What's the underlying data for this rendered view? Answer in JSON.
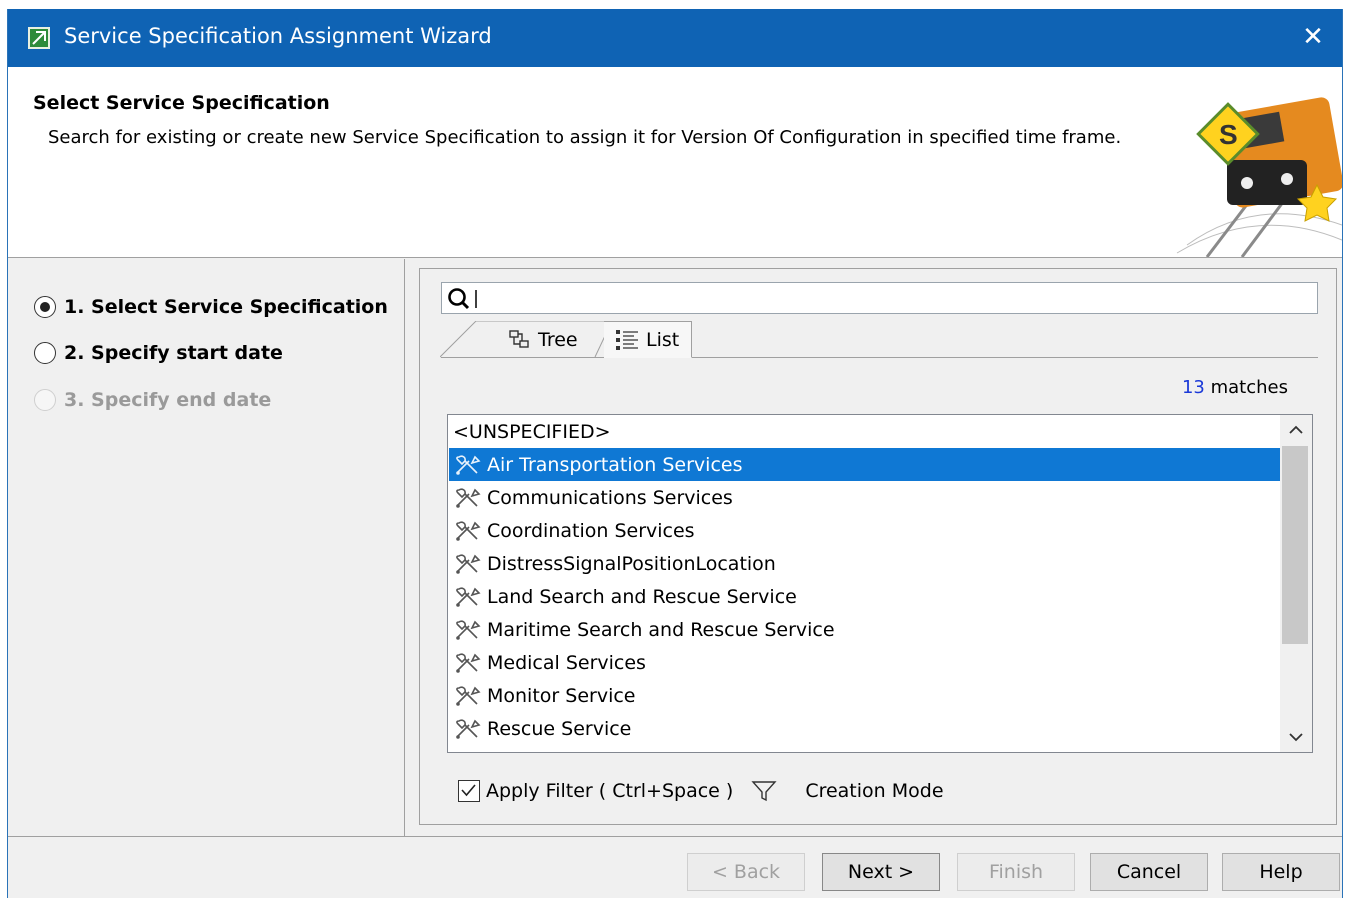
{
  "window": {
    "title": "Service Specification Assignment Wizard",
    "close_label": "✕"
  },
  "banner": {
    "title": "Select Service Specification",
    "description": "Search for existing or create new Service Specification to assign it for Version Of Configuration in specified time frame."
  },
  "steps": [
    {
      "label": "1. Select Service Specification",
      "state": "selected"
    },
    {
      "label": "2. Specify start date",
      "state": "enabled"
    },
    {
      "label": "3. Specify end date",
      "state": "disabled"
    }
  ],
  "search": {
    "value": "",
    "placeholder": ""
  },
  "tabs": {
    "tree_label": "Tree",
    "list_label": "List",
    "active": "List"
  },
  "matches": {
    "count": "13",
    "label": "matches"
  },
  "list": {
    "items": [
      {
        "label": "<UNSPECIFIED>",
        "icon": "none",
        "selected": false
      },
      {
        "label": "Air Transportation Services",
        "icon": "service-specification-icon",
        "selected": true
      },
      {
        "label": "Communications Services",
        "icon": "service-specification-icon",
        "selected": false
      },
      {
        "label": "Coordination Services",
        "icon": "service-specification-icon",
        "selected": false
      },
      {
        "label": "DistressSignalPositionLocation",
        "icon": "service-specification-icon",
        "selected": false
      },
      {
        "label": "Land Search and Rescue Service",
        "icon": "service-specification-icon",
        "selected": false
      },
      {
        "label": "Maritime Search and Rescue Service",
        "icon": "service-specification-icon",
        "selected": false
      },
      {
        "label": "Medical Services",
        "icon": "service-specification-icon",
        "selected": false
      },
      {
        "label": "Monitor Service",
        "icon": "service-specification-icon",
        "selected": false
      },
      {
        "label": "Rescue Service",
        "icon": "service-specification-icon",
        "selected": false
      }
    ]
  },
  "filter": {
    "apply_label": "Apply Filter ( Ctrl+Space )",
    "apply_checked": true,
    "creation_mode_label": "Creation Mode"
  },
  "buttons": {
    "back": "< Back",
    "next": "Next >",
    "finish": "Finish",
    "cancel": "Cancel",
    "help": "Help"
  },
  "colors": {
    "titlebar": "#0f63b4",
    "selection": "#0f78d4",
    "match_count": "#1a39d8"
  }
}
